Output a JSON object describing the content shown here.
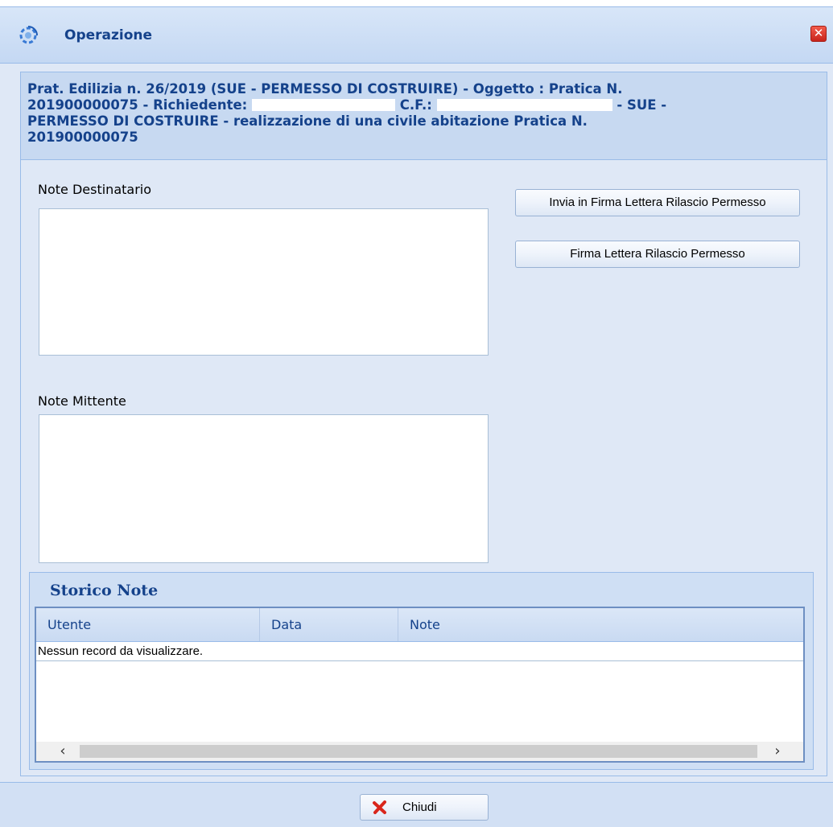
{
  "window": {
    "title": "Operazione",
    "close_icon": "close-icon",
    "title_icon": "gear-refresh-icon"
  },
  "header": {
    "line1": "Prat. Edilizia n. 26/2019 (SUE - PERMESSO DI COSTRUIRE) - Oggetto : Pratica N.",
    "line2_a": "201900000075 - Richiedente: ",
    "line2_b": " C.F.: ",
    "line2_c": " - SUE -",
    "line3": "PERMESSO DI COSTRUIRE - realizzazione di una civile abitazione Pratica N.",
    "line4": "201900000075"
  },
  "form": {
    "note_destinatario_label": "Note Destinatario",
    "note_destinatario_value": "",
    "note_mittente_label": "Note Mittente",
    "note_mittente_value": ""
  },
  "actions": {
    "invia_firma_label": "Invia in Firma Lettera Rilascio Permesso",
    "firma_label": "Firma Lettera Rilascio Permesso"
  },
  "storico": {
    "title": "Storico Note",
    "columns": [
      "Utente",
      "Data",
      "Note"
    ],
    "empty_text": "Nessun record da visualizzare."
  },
  "footer": {
    "close_label": "Chiudi"
  },
  "colors": {
    "title_text": "#15428b",
    "panel_bg": "#dfe8f6",
    "border": "#99bbe8"
  }
}
